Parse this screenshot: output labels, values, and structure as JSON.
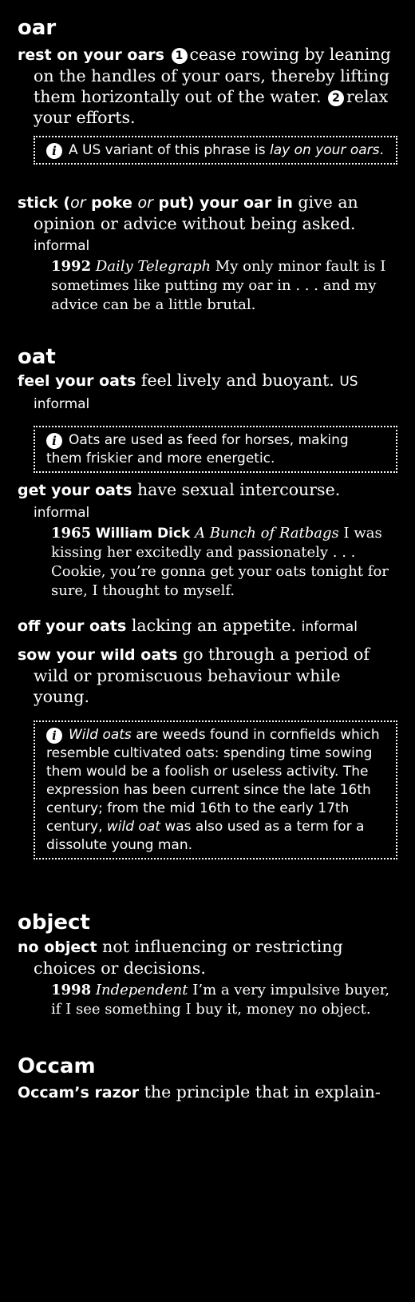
{
  "oar": {
    "headword": "oar",
    "e1": {
      "phrase": "rest on your oars",
      "n1": "1",
      "def1": "cease rowing by leaning on the handles of your oars, thereby lifting them horizontally out of the water.",
      "n2": "2",
      "def2": "relax your efforts."
    },
    "note1": {
      "pre": "A US variant of this phrase is ",
      "em": "lay on your oars",
      "post": "."
    },
    "e2": {
      "p1": "stick (",
      "p2": "or",
      "p3": " poke ",
      "p4": "or",
      "p5": " put) your oar in",
      "def": "give an opinion or advice without being asked.",
      "label": "informal"
    },
    "q1": {
      "year": "1992",
      "src": "Daily Telegraph",
      "text": "My only minor fault is I sometimes like putting my oar in . . . and my advice can be a little brutal."
    }
  },
  "oat": {
    "headword": "oat",
    "e1": {
      "phrase": "feel your oats",
      "def": "feel lively and buoyant.",
      "label": "US informal"
    },
    "note1": {
      "text": "Oats are used as feed for horses, making them friskier and more energetic."
    },
    "e2": {
      "phrase": "get your oats",
      "def": "have sexual intercourse.",
      "label": "informal"
    },
    "q1": {
      "year": "1965",
      "src": "William Dick",
      "title": "A Bunch of Ratbags",
      "text": "I was kissing her excitedly and passionately . . . Cookie, you’re gonna get your oats tonight for sure, I thought to myself."
    },
    "e3": {
      "phrase": "off your oats",
      "def": "lacking an appetite.",
      "label": "informal"
    },
    "e4": {
      "phrase": "sow your wild oats",
      "def": "go through a period of wild or promiscuous behaviour while young."
    },
    "note2": {
      "em1": "Wild oats",
      "t1": " are weeds found in cornfields which resemble cultivated oats: spending time sowing them would be a foolish or useless activity. The expression has been current since the late 16th century; from the mid 16th to the early 17th century, ",
      "em2": "wild oat",
      "t2": " was also used as a term for a dissolute young man."
    }
  },
  "object": {
    "headword": "object",
    "e1": {
      "phrase": "no object",
      "def": "not influencing or restricting choices or decisions."
    },
    "q1": {
      "year": "1998",
      "src": "Independent",
      "text": "I’m a very impulsive buyer, if I see something I buy it, money no object."
    }
  },
  "occam": {
    "headword": "Occam",
    "e1": {
      "phrase": "Occam’s razor",
      "def": "the principle that in explain-"
    }
  }
}
